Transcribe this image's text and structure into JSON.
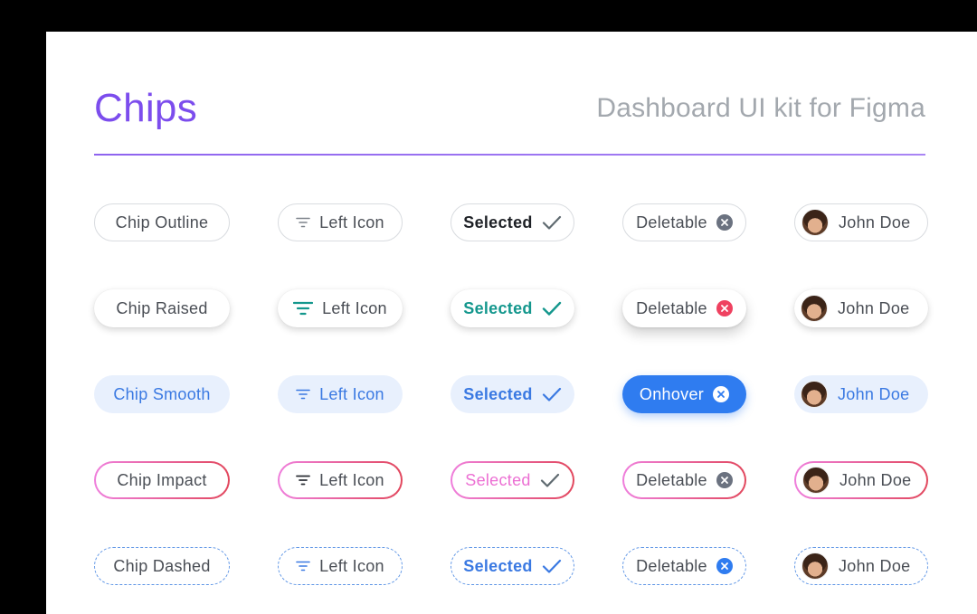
{
  "header": {
    "title": "Chips",
    "subtitle": "Dashboard UI kit for Figma"
  },
  "colors": {
    "accent": "#7c4ded",
    "teal": "#14978d",
    "blue": "#2f7cf0",
    "impact_start": "#ef7fdc",
    "impact_end": "#e2475d"
  },
  "rows": [
    {
      "style": "outline",
      "chip": "Chip Outline",
      "left_icon": "Left Icon",
      "selected": "Selected",
      "deletable": "Deletable",
      "user": "John Doe"
    },
    {
      "style": "raised",
      "chip": "Chip Raised",
      "left_icon": "Left Icon",
      "selected": "Selected",
      "deletable": "Deletable",
      "user": "John Doe"
    },
    {
      "style": "smooth",
      "chip": "Chip Smooth",
      "left_icon": "Left Icon",
      "selected": "Selected",
      "deletable": "Onhover",
      "user": "John Doe"
    },
    {
      "style": "impact",
      "chip": "Chip Impact",
      "left_icon": "Left Icon",
      "selected": "Selected",
      "deletable": "Deletable",
      "user": "John Doe"
    },
    {
      "style": "dashed",
      "chip": "Chip Dashed",
      "left_icon": "Left Icon",
      "selected": "Selected",
      "deletable": "Deletable",
      "user": "John Doe"
    }
  ],
  "icons": {
    "left": "filter-icon",
    "selected": "check-icon",
    "delete": "close-circle-icon",
    "user": "avatar"
  }
}
